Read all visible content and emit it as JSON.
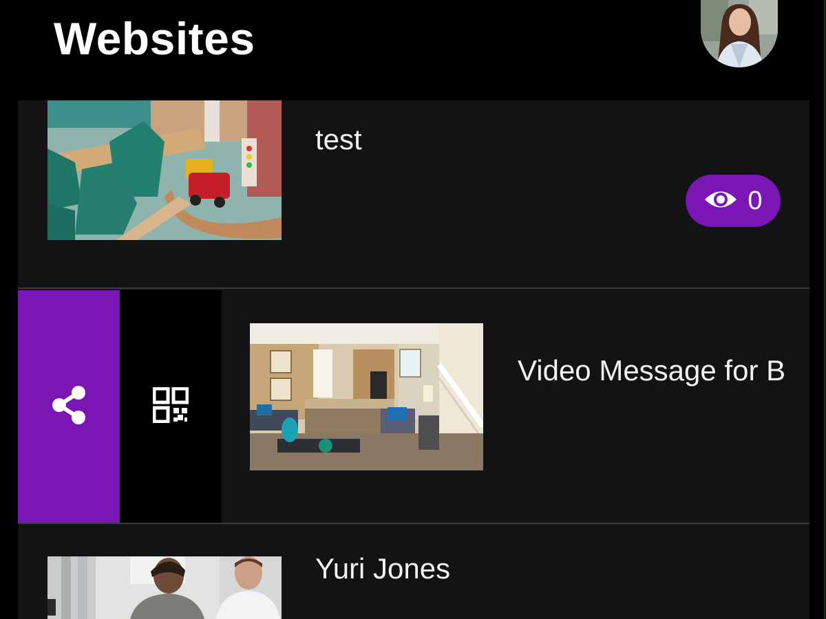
{
  "header": {
    "title": "Websites",
    "avatar_icon": "user-avatar"
  },
  "websites": [
    {
      "title": "test",
      "views": "0",
      "thumbnail": "toy-train-table-photo"
    },
    {
      "title": "Video Message for B",
      "thumbnail": "living-room-photo",
      "actions": {
        "share_icon": "share-icon",
        "qr_icon": "qr-code-icon"
      }
    },
    {
      "title": "Yuri Jones",
      "thumbnail": "people-kitchen-photo"
    }
  ],
  "colors": {
    "background": "#000000",
    "row_background": "#131215",
    "accent_purple": "#7a16b3",
    "divider": "#3b3a3e",
    "text": "#ffffff"
  }
}
